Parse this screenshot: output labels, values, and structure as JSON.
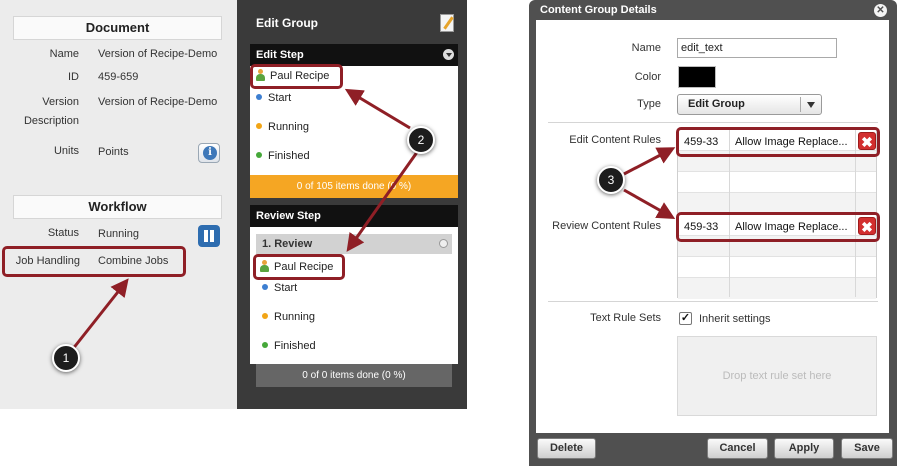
{
  "document_section": {
    "header": "Document",
    "fields": [
      {
        "label": "Name",
        "value": "Version of Recipe-Demo"
      },
      {
        "label": "ID",
        "value": "459-659"
      },
      {
        "label": "Version",
        "label2": "Description",
        "value": "Version of Recipe-Demo"
      },
      {
        "label": "Units",
        "value": "Points"
      }
    ],
    "info_icon": "info-icon"
  },
  "workflow_section": {
    "header": "Workflow",
    "fields": [
      {
        "label": "Status",
        "value": "Running"
      },
      {
        "label": "Job Handling",
        "value": "Combine Jobs"
      }
    ],
    "pause_icon": "pause-icon"
  },
  "edit_group_panel": {
    "title": "Edit Group",
    "edit_step": {
      "header": "Edit Step",
      "user": "Paul Recipe",
      "statuses": [
        "Start",
        "Running",
        "Finished"
      ],
      "progress_text": "0 of 105 items done (0 %)",
      "progress_color": "#f5a623"
    },
    "review_step": {
      "header": "Review Step",
      "sub_header": "1. Review",
      "user": "Paul Recipe",
      "statuses": [
        "Start",
        "Running",
        "Finished"
      ],
      "progress_text": "0 of 0 items done (0 %)",
      "progress_color": "#666666"
    },
    "status_colors": [
      "#3d7fd1",
      "#f2a516",
      "#46a83a"
    ]
  },
  "dialog": {
    "title": "Content Group Details",
    "labels": {
      "name": "Name",
      "color": "Color",
      "type": "Type",
      "edit_rules": "Edit Content Rules",
      "review_rules": "Review Content Rules",
      "text_rule_sets": "Text Rule Sets"
    },
    "name_value": "edit_text",
    "color_value": "#000000",
    "type_value": "Edit Group",
    "edit_rules": [
      {
        "id": "459-33",
        "rule": "Allow Image Replace..."
      }
    ],
    "review_rules": [
      {
        "id": "459-33",
        "rule": "Allow Image Replace..."
      }
    ],
    "inherit_label": "Inherit settings",
    "inherit_checked": true,
    "drop_zone_text": "Drop text rule set here",
    "buttons": {
      "delete": "Delete",
      "cancel": "Cancel",
      "apply": "Apply",
      "save": "Save"
    }
  },
  "callouts": [
    "1",
    "2",
    "3"
  ],
  "highlight_color": "#8f1f26"
}
